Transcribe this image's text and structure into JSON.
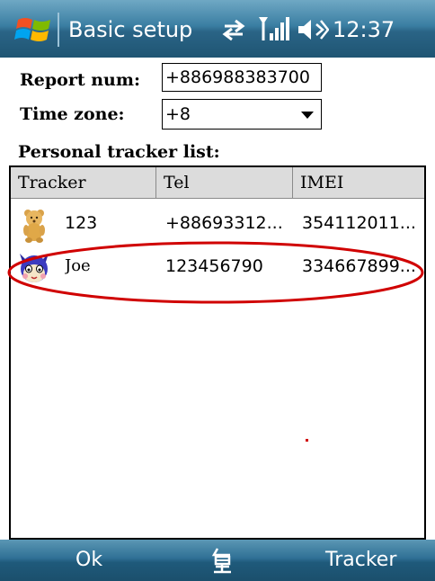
{
  "titlebar": {
    "title": "Basic setup",
    "time": "12:37",
    "icons": [
      "windows-flag-icon",
      "sync-icon",
      "signal-icon",
      "volume-icon"
    ]
  },
  "form": {
    "report_label": "Report num:",
    "report_value": "+886988383700",
    "timezone_label": "Time zone:",
    "timezone_value": "+8",
    "list_label": "Personal tracker list:"
  },
  "table": {
    "columns": [
      "Tracker",
      "Tel",
      "IMEI"
    ],
    "rows": [
      {
        "name": "123",
        "tel": "+88693312...",
        "imei": "354112011...",
        "avatar": "bear-avatar-icon"
      },
      {
        "name": "Joe",
        "tel": "123456790",
        "imei": "334667899...",
        "avatar": "cat-avatar-icon"
      }
    ]
  },
  "softkeys": {
    "left": "Ok",
    "center_icon": "keyboard-icon",
    "right": "Tracker"
  },
  "colors": {
    "titlebar": "#2a6486",
    "softkey_bar": "#2f7095",
    "highlight": "#d00000",
    "header_bg": "#dcdcdc"
  }
}
